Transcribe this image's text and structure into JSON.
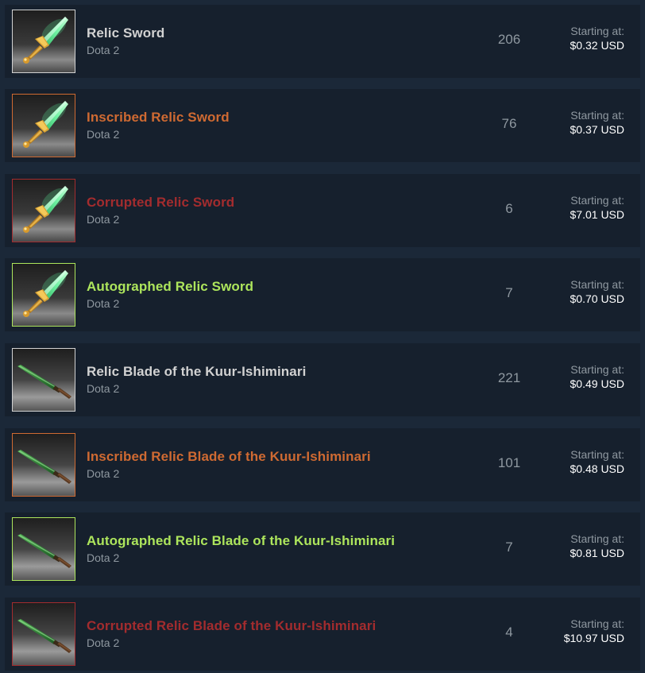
{
  "labels": {
    "starting_at": "Starting at:"
  },
  "quality_colors": {
    "normal": "#d2d2d2",
    "inscribed": "#cf6a32",
    "corrupted": "#a32c2e",
    "autographed": "#ade55c"
  },
  "items": [
    {
      "name": "Relic Sword",
      "game": "Dota 2",
      "quantity": "206",
      "price": "$0.32 USD",
      "quality": "normal",
      "icon": "relic-sword-icon"
    },
    {
      "name": "Inscribed Relic Sword",
      "game": "Dota 2",
      "quantity": "76",
      "price": "$0.37 USD",
      "quality": "inscribed",
      "icon": "relic-sword-icon"
    },
    {
      "name": "Corrupted Relic Sword",
      "game": "Dota 2",
      "quantity": "6",
      "price": "$7.01 USD",
      "quality": "corrupted",
      "icon": "relic-sword-icon"
    },
    {
      "name": "Autographed Relic Sword",
      "game": "Dota 2",
      "quantity": "7",
      "price": "$0.70 USD",
      "quality": "autographed",
      "icon": "relic-sword-icon"
    },
    {
      "name": "Relic Blade of the Kuur-Ishiminari",
      "game": "Dota 2",
      "quantity": "221",
      "price": "$0.49 USD",
      "quality": "normal",
      "icon": "relic-blade-icon"
    },
    {
      "name": "Inscribed Relic Blade of the Kuur-Ishiminari",
      "game": "Dota 2",
      "quantity": "101",
      "price": "$0.48 USD",
      "quality": "inscribed",
      "icon": "relic-blade-icon"
    },
    {
      "name": "Autographed Relic Blade of the Kuur-Ishiminari",
      "game": "Dota 2",
      "quantity": "7",
      "price": "$0.81 USD",
      "quality": "autographed",
      "icon": "relic-blade-icon"
    },
    {
      "name": "Corrupted Relic Blade of the Kuur-Ishiminari",
      "game": "Dota 2",
      "quantity": "4",
      "price": "$10.97 USD",
      "quality": "corrupted",
      "icon": "relic-blade-icon"
    }
  ]
}
